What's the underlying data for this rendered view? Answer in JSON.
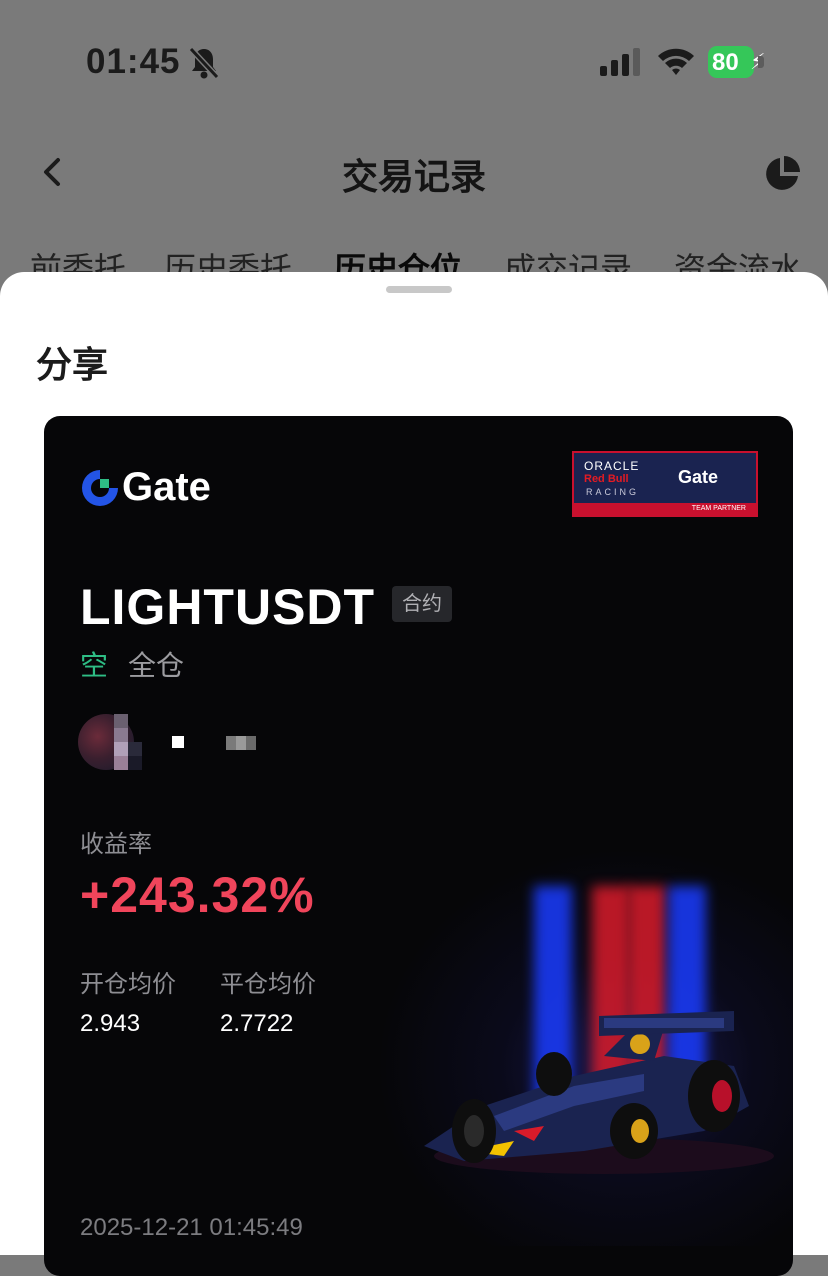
{
  "status_bar": {
    "time": "01:45",
    "battery": "80"
  },
  "nav": {
    "title": "交易记录"
  },
  "tabs": [
    {
      "label": "前委托"
    },
    {
      "label": "历史委托"
    },
    {
      "label": "历史仓位",
      "active": true
    },
    {
      "label": "成交记录"
    },
    {
      "label": "资金流水"
    }
  ],
  "sheet": {
    "title": "分享",
    "card": {
      "brand": "Gate",
      "partner": {
        "oracle": "ORACLE",
        "redbull": "Red Bull",
        "racing": "RACING",
        "gate": "Gate",
        "team": "TEAM PARTNER"
      },
      "symbol": "LIGHTUSDT",
      "contract_tag": "合约",
      "side": "空",
      "margin_mode": "全仓",
      "ratio_label": "收益率",
      "ratio": "+243.32%",
      "open_label": "开仓均价",
      "open_price": "2.943",
      "close_label": "平仓均价",
      "close_price": "2.7722",
      "timestamp": "2025-12-21 01:45:49"
    }
  },
  "colors": {
    "positive": "#f0455b",
    "short": "#2ebd85",
    "brand_blue": "#2354e6"
  },
  "icons": [
    "back-chevron-icon",
    "pie-chart-icon",
    "bell-slash-icon",
    "signal-icon",
    "wifi-icon"
  ]
}
